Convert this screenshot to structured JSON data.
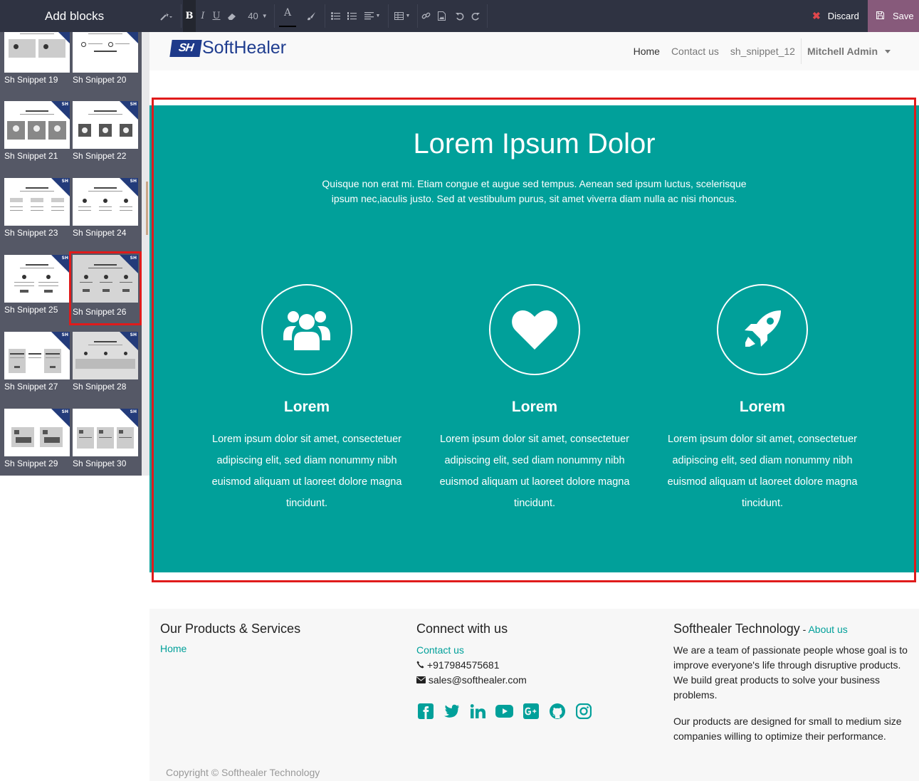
{
  "sidebar": {
    "title": "Add blocks",
    "snippets": [
      {
        "label": "Sh Snippet 19"
      },
      {
        "label": "Sh Snippet 20"
      },
      {
        "label": "Sh Snippet 21"
      },
      {
        "label": "Sh Snippet 22"
      },
      {
        "label": "Sh Snippet 23"
      },
      {
        "label": "Sh Snippet 24"
      },
      {
        "label": "Sh Snippet 25"
      },
      {
        "label": "Sh Snippet 26"
      },
      {
        "label": "Sh Snippet 27"
      },
      {
        "label": "Sh Snippet 28"
      },
      {
        "label": "Sh Snippet 29"
      },
      {
        "label": "Sh Snippet 30"
      }
    ],
    "selected_snippet": "Sh Snippet 26",
    "thumb_badge": "SH"
  },
  "toolbar": {
    "font_size": "40",
    "discard_label": "Discard",
    "save_label": "Save"
  },
  "header": {
    "logo_mark": "SH",
    "logo_text": "SoftHealer",
    "nav": [
      {
        "label": "Home",
        "active": true
      },
      {
        "label": "Contact us",
        "active": false
      },
      {
        "label": "sh_snippet_12",
        "active": false
      }
    ],
    "user": "Mitchell Admin"
  },
  "section": {
    "title": "Lorem Ipsum Dolor",
    "subtitle": "Quisque non erat mi. Etiam congue et augue sed tempus. Aenean sed ipsum luctus, scelerisque ipsum nec,iaculis justo. Sed at vestibulum purus, sit amet viverra diam nulla ac nisi rhoncus.",
    "background": "#01a09a",
    "features": [
      {
        "icon": "users-icon",
        "heading": "Lorem",
        "text": "Lorem ipsum dolor sit amet, consectetuer adipiscing elit, sed diam nonummy nibh euismod aliquam ut laoreet dolore magna tincidunt."
      },
      {
        "icon": "heart-icon",
        "heading": "Lorem",
        "text": "Lorem ipsum dolor sit amet, consectetuer adipiscing elit, sed diam nonummy nibh euismod aliquam ut laoreet dolore magna tincidunt."
      },
      {
        "icon": "rocket-icon",
        "heading": "Lorem",
        "text": "Lorem ipsum dolor sit amet, consectetuer adipiscing elit, sed diam nonummy nibh euismod aliquam ut laoreet dolore magna tincidunt."
      }
    ]
  },
  "footer": {
    "col1_title": "Our Products & Services",
    "col1_link": "Home",
    "col2_title": "Connect with us",
    "col2_link": "Contact us",
    "phone": "+917984575681",
    "email": "sales@softhealer.com",
    "social": [
      "facebook-icon",
      "twitter-icon",
      "linkedin-icon",
      "youtube-icon",
      "google-plus-icon",
      "github-icon",
      "instagram-icon"
    ],
    "col3_title": "Softhealer Technology",
    "col3_sep": " - ",
    "col3_link": "About us",
    "about_p1": "We are a team of passionate people whose goal is to improve everyone's life through disruptive products. We build great products to solve your business problems.",
    "about_p2": "Our products are designed for small to medium size companies willing to optimize their performance.",
    "copyright": "Copyright © Softhealer Technology"
  },
  "colors": {
    "accent": "#01a09a",
    "toolbar_bg": "#2f3342",
    "save_bg": "#875a7b",
    "selection": "#e01b1b"
  }
}
